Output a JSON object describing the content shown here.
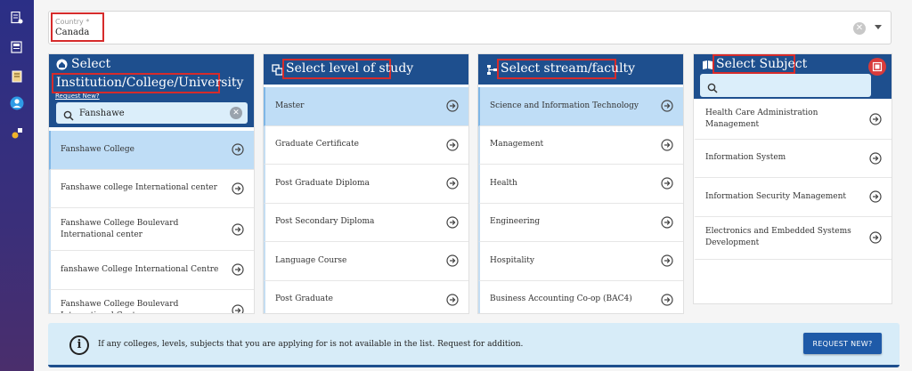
{
  "country": {
    "label": "Country *",
    "value": "Canada"
  },
  "institution": {
    "title_line1": "Select",
    "title_line2": "Institution/College/University",
    "request_link": "Request New?",
    "search_value": "Fanshawe",
    "items": [
      "Fanshawe College",
      "Fanshawe college International center",
      "Fanshawe College Boulevard International center",
      "fanshawe College International Centre",
      "Fanshawe College Boulevard International Centre"
    ]
  },
  "level": {
    "title": "Select level of study",
    "items": [
      "Master",
      "Graduate Certificate",
      "Post Graduate Diploma",
      "Post Secondary Diploma",
      "Language Course",
      "Post Graduate"
    ]
  },
  "stream": {
    "title": "Select stream/faculty",
    "items": [
      "Science and Information Technology",
      "Management",
      "Health",
      "Engineering",
      "Hospitality",
      "Business Accounting Co-op (BAC4)"
    ]
  },
  "subject": {
    "title": "Select Subject",
    "search_value": "",
    "items": [
      "Health Care Administration Management",
      "Information System",
      "Information Security Management",
      "Electronics and Embedded Systems Development"
    ]
  },
  "banner": {
    "text": "If any colleges, levels, subjects that you are applying for is not available in the list. Request for addition.",
    "button_label": "REQUEST NEW?"
  },
  "colors": {
    "header_blue": "#1e4f8e",
    "active_row": "#bfddf6",
    "highlight_red": "#d62b2b",
    "button_blue": "#1e5aa8"
  }
}
